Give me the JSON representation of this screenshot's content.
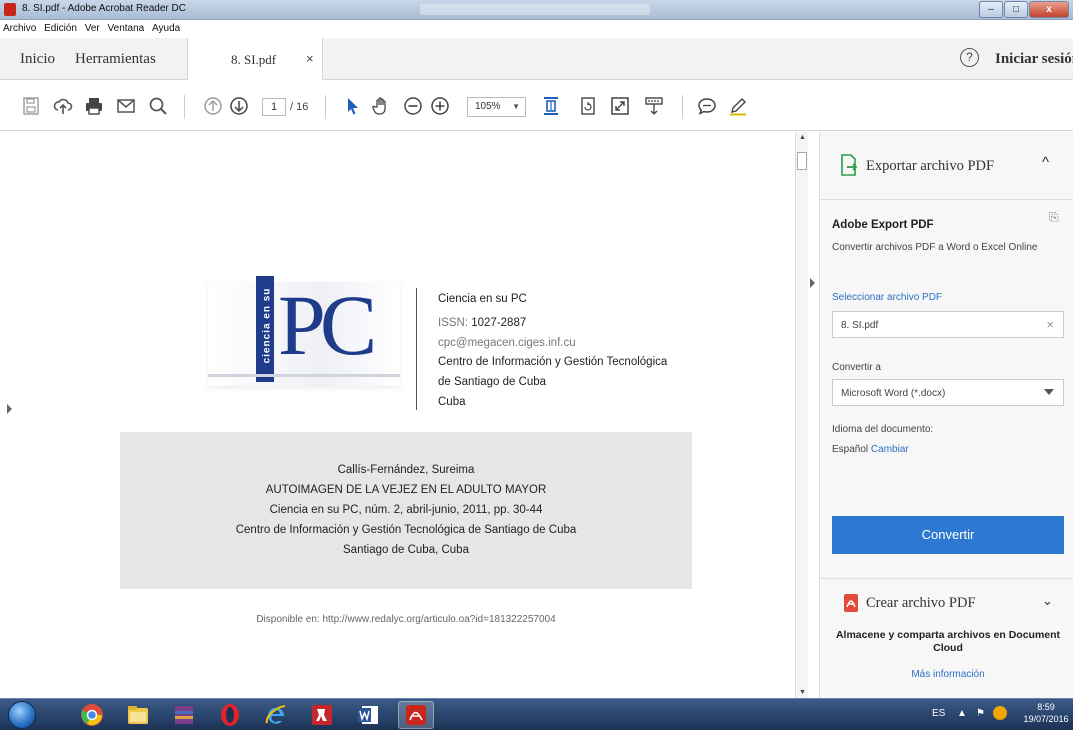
{
  "window": {
    "title": "8. SI.pdf - Adobe Acrobat Reader DC"
  },
  "menubar": {
    "items": [
      "Archivo",
      "Edición",
      "Ver",
      "Ventana",
      "Ayuda"
    ]
  },
  "nav": {
    "inicio": "Inicio",
    "herramientas": "Herramientas",
    "tab_label": "8. SI.pdf",
    "tab_close": "×",
    "help": "?",
    "signin": "Iniciar sesión"
  },
  "toolbar": {
    "page_current": "1",
    "page_total": "/ 16",
    "zoom": "105%",
    "zoom_arrow": "▼"
  },
  "document": {
    "logo_vertical_text": "ciencia en su",
    "logo_text": "PC",
    "journal_name": "Ciencia en su PC",
    "issn_label": "ISSN:",
    "issn_value": "1027-2887",
    "email": "cpc@megacen.ciges.inf.cu",
    "institution_line1": "Centro de Información y Gestión Tecnológica",
    "institution_line2": "de Santiago de Cuba",
    "country": "Cuba",
    "citation": {
      "author": "Callís-Fernández, Sureima",
      "title": "AUTOIMAGEN DE LA VEJEZ EN EL ADULTO MAYOR",
      "source": "Ciencia en su PC, núm. 2, abril-junio, 2011, pp. 30-44",
      "publisher": "Centro de Información y Gestión Tecnológica de Santiago de Cuba",
      "place": "Santiago de Cuba, Cuba"
    },
    "available_at": "Disponible en: http://www.redalyc.org/articulo.oa?id=181322257004"
  },
  "right_panel": {
    "export_title": "Exportar archivo PDF",
    "export_chevron": "^",
    "service_name": "Adobe Export PDF",
    "service_desc": "Convertir archivos PDF a Word o Excel Online",
    "select_label": "Seleccionar archivo PDF",
    "selected_file": "8. SI.pdf",
    "clear_x": "×",
    "convert_to_label": "Convertir a",
    "convert_format": "Microsoft Word (*.docx)",
    "doc_lang_label": "Idioma del documento:",
    "doc_lang_value": "Español",
    "change_link": "Cambiar",
    "convert_button": "Convertir",
    "create_title": "Crear archivo PDF",
    "create_chevron": "⌄",
    "cloud_desc": "Almacene y comparta archivos en Document Cloud",
    "more_info": "Más información"
  },
  "taskbar": {
    "lang": "ES",
    "time": "8:59",
    "date": "19/07/2016"
  }
}
